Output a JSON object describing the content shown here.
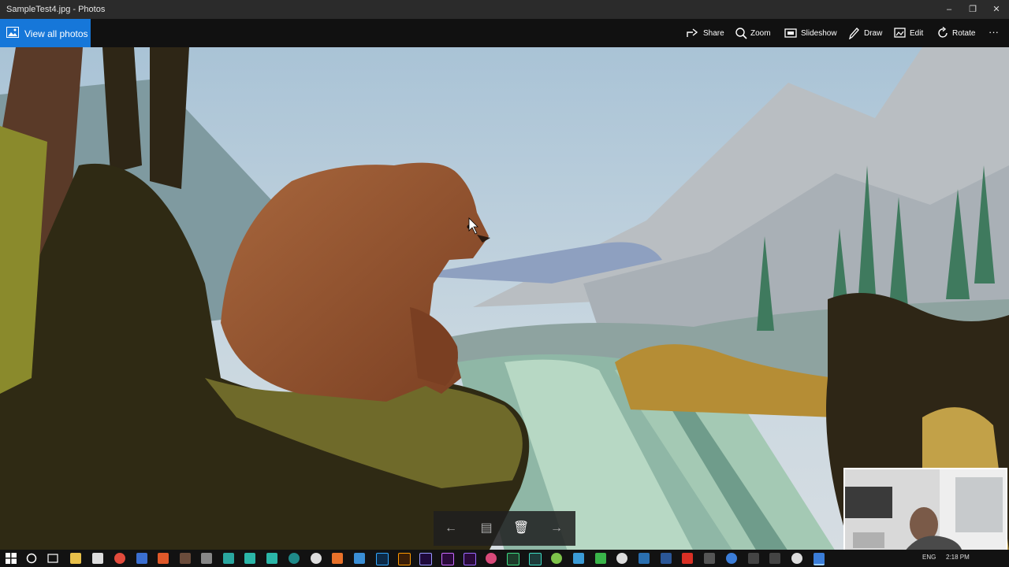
{
  "window": {
    "title": "SampleTest4.jpg - Photos"
  },
  "toolbar": {
    "view_all_label": "View all photos",
    "share_label": "Share",
    "zoom_label": "Zoom",
    "slideshow_label": "Slideshow",
    "draw_label": "Draw",
    "edit_label": "Edit",
    "rotate_label": "Rotate",
    "more_label": "···"
  },
  "window_controls": {
    "minimize": "–",
    "maximize": "❐",
    "close": "✕"
  },
  "filmstrip": {
    "prev": "←",
    "info": "▤",
    "delete": "🗑",
    "next": "→"
  },
  "taskbar": {
    "language": "ENG",
    "time": "2:18 PM",
    "apps": [
      "windows-icon",
      "cortana-icon",
      "task-view-icon",
      "file-explorer-icon",
      "mail-icon",
      "chrome-icon",
      "app-icon",
      "app-icon",
      "app-icon",
      "app-icon",
      "app-icon",
      "app-icon",
      "app-icon",
      "app-icon",
      "app-icon",
      "app-icon",
      "photoshop-icon",
      "illustrator-icon",
      "aftereffects-icon",
      "app-icon",
      "premiere-icon",
      "app-icon",
      "app-icon",
      "app-icon",
      "app-icon",
      "app-icon",
      "app-icon",
      "app-icon",
      "app-icon",
      "app-icon",
      "word-icon",
      "acrobat-icon",
      "app-icon",
      "clock-icon",
      "app-icon",
      "app-icon",
      "app-icon",
      "photos-icon"
    ]
  },
  "colors": {
    "accent": "#1677d9",
    "titlebar": "#2b2b2b",
    "toolbar": "#111111"
  }
}
